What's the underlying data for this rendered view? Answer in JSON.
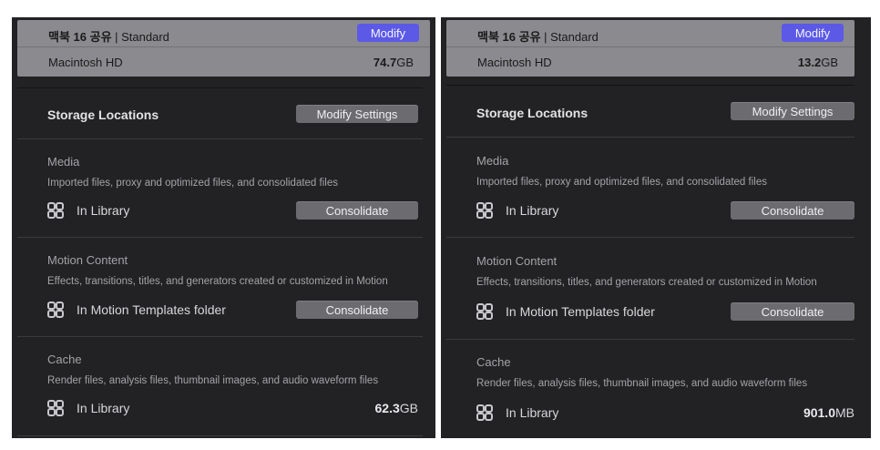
{
  "panels": [
    {
      "disk_name_bold": "맥북 16 공유",
      "disk_name_rest": " | Standard",
      "modify_label": "Modify",
      "volume": "Macintosh HD",
      "capacity_value": "74.7",
      "capacity_unit": "GB",
      "storage_title": "Storage Locations",
      "modify_settings_label": "Modify Settings",
      "media": {
        "title": "Media",
        "desc": "Imported files, proxy and optimized files, and consolidated files",
        "location": "In Library",
        "button": "Consolidate"
      },
      "motion": {
        "title": "Motion Content",
        "desc": "Effects, transitions, titles, and generators created or customized in Motion",
        "location": "In Motion Templates folder",
        "button": "Consolidate"
      },
      "cache": {
        "title": "Cache",
        "desc": "Render files, analysis files, thumbnail images, and audio waveform files",
        "location": "In Library",
        "size_value": "62.3",
        "size_unit": "GB"
      }
    },
    {
      "disk_name_bold": "맥북 16 공유",
      "disk_name_rest": " | Standard",
      "modify_label": "Modify",
      "volume": "Macintosh HD",
      "capacity_value": "13.2",
      "capacity_unit": "GB",
      "storage_title": "Storage Locations",
      "modify_settings_label": "Modify Settings",
      "media": {
        "title": "Media",
        "desc": "Imported files, proxy and optimized files, and consolidated files",
        "location": "In Library",
        "button": "Consolidate"
      },
      "motion": {
        "title": "Motion Content",
        "desc": "Effects, transitions, titles, and generators created or customized in Motion",
        "location": "In Motion Templates folder",
        "button": "Consolidate"
      },
      "cache": {
        "title": "Cache",
        "desc": "Render files, analysis files, thumbnail images, and audio waveform files",
        "location": "In Library",
        "size_value": "901.0",
        "size_unit": "MB"
      }
    }
  ],
  "icons": {
    "location": "library-grid-icon"
  },
  "colors": {
    "accent": "#5c59e6",
    "panel_bg": "#222224",
    "header_bg": "#8b8b8f"
  }
}
